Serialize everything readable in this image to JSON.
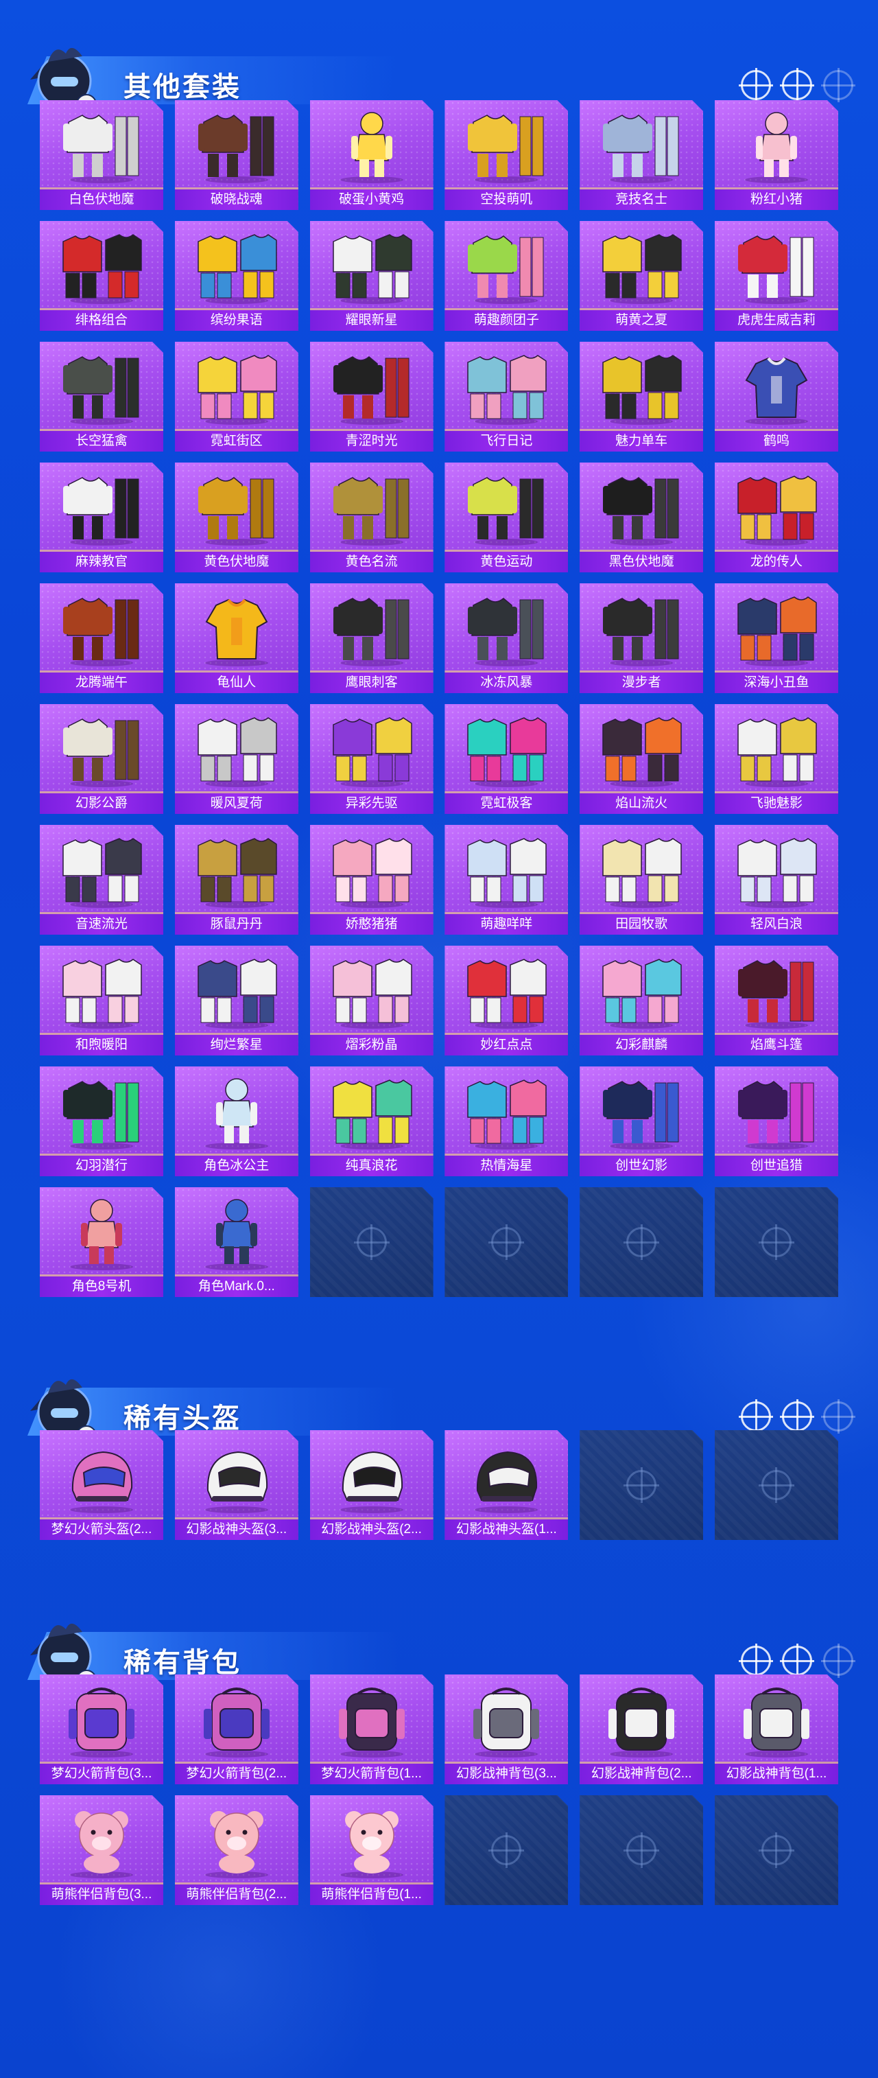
{
  "sections": [
    {
      "id": "suits",
      "title": "其他套装",
      "items": [
        {
          "name": "白色伏地魔",
          "kind": "suit",
          "colors": [
            "#eeeeee",
            "#cfcfcf"
          ]
        },
        {
          "name": "破晓战魂",
          "kind": "suit",
          "colors": [
            "#6b3b2a",
            "#3a2b2b"
          ]
        },
        {
          "name": "破蛋小黄鸡",
          "kind": "mascot",
          "colors": [
            "#ffd84a",
            "#fff1a8"
          ]
        },
        {
          "name": "空投萌叽",
          "kind": "suit",
          "colors": [
            "#f0c43a",
            "#d9a020"
          ]
        },
        {
          "name": "竞技名士",
          "kind": "suit",
          "colors": [
            "#9fb4d8",
            "#c6d3ea"
          ]
        },
        {
          "name": "粉红小猪",
          "kind": "mascot",
          "colors": [
            "#f7c0cf",
            "#ffe0e8"
          ]
        },
        {
          "name": "绯格组合",
          "kind": "set",
          "colors": [
            "#d42a2a",
            "#222222"
          ]
        },
        {
          "name": "缤纷果语",
          "kind": "set",
          "colors": [
            "#f4c21d",
            "#3a8fd8"
          ]
        },
        {
          "name": "耀眼新星",
          "kind": "set",
          "colors": [
            "#f2f2f2",
            "#2f3a2f"
          ]
        },
        {
          "name": "萌趣颜团子",
          "kind": "suit",
          "colors": [
            "#9ad84a",
            "#f08ab0"
          ]
        },
        {
          "name": "萌黄之夏",
          "kind": "set",
          "colors": [
            "#f3cf3a",
            "#2a2a2a"
          ]
        },
        {
          "name": "虎虎生威吉莉",
          "kind": "suit",
          "colors": [
            "#d42a3a",
            "#f5f5f5"
          ]
        },
        {
          "name": "长空猛禽",
          "kind": "suit",
          "colors": [
            "#4a4f4a",
            "#2b2f2b"
          ]
        },
        {
          "name": "霓虹街区",
          "kind": "set",
          "colors": [
            "#f5d43a",
            "#f08ac0"
          ]
        },
        {
          "name": "青涩时光",
          "kind": "suit",
          "colors": [
            "#222222",
            "#b42a2a"
          ]
        },
        {
          "name": "飞行日记",
          "kind": "set",
          "colors": [
            "#7fc2d8",
            "#f0a0c0"
          ]
        },
        {
          "name": "魅力单车",
          "kind": "set",
          "colors": [
            "#e8c42a",
            "#2a2a2a"
          ]
        },
        {
          "name": "鹤鸣",
          "kind": "hoodie",
          "colors": [
            "#3a4fb4",
            "#e8e8f0"
          ]
        },
        {
          "name": "麻辣教官",
          "kind": "suit",
          "colors": [
            "#f2f2f2",
            "#222222"
          ]
        },
        {
          "name": "黄色伏地魔",
          "kind": "suit",
          "colors": [
            "#d9a020",
            "#b07a10"
          ]
        },
        {
          "name": "黄色名流",
          "kind": "suit",
          "colors": [
            "#b0913a",
            "#8a6f2a"
          ]
        },
        {
          "name": "黄色运动",
          "kind": "suit",
          "colors": [
            "#d8e04a",
            "#2a2a2a"
          ]
        },
        {
          "name": "黑色伏地魔",
          "kind": "suit",
          "colors": [
            "#1e1e1e",
            "#3a3a3a"
          ]
        },
        {
          "name": "龙的传人",
          "kind": "set",
          "colors": [
            "#c8202a",
            "#f0c040"
          ]
        },
        {
          "name": "龙腾端午",
          "kind": "suit",
          "colors": [
            "#a8401e",
            "#6a2a14"
          ]
        },
        {
          "name": "龟仙人",
          "kind": "shirt",
          "colors": [
            "#f4b81a",
            "#f08a1a"
          ]
        },
        {
          "name": "鹰眼刺客",
          "kind": "suit",
          "colors": [
            "#2a2a2a",
            "#4a4a4a"
          ]
        },
        {
          "name": "冰冻风暴",
          "kind": "suit",
          "colors": [
            "#2f3338",
            "#4a5058"
          ]
        },
        {
          "name": "漫步者",
          "kind": "suit",
          "colors": [
            "#2a2a2a",
            "#3c3c3c"
          ]
        },
        {
          "name": "深海小丑鱼",
          "kind": "set",
          "colors": [
            "#2a3a6a",
            "#e86a2a"
          ]
        },
        {
          "name": "幻影公爵",
          "kind": "suit",
          "colors": [
            "#e8e4d8",
            "#6a4a2a"
          ]
        },
        {
          "name": "暖风夏荷",
          "kind": "set",
          "colors": [
            "#f2f2f2",
            "#c8c8c8"
          ]
        },
        {
          "name": "异彩先驱",
          "kind": "set",
          "colors": [
            "#8a3ad8",
            "#f0d040"
          ]
        },
        {
          "name": "霓虹极客",
          "kind": "set",
          "colors": [
            "#2ad0c0",
            "#e83a9a"
          ]
        },
        {
          "name": "焰山流火",
          "kind": "set",
          "colors": [
            "#3a2a3a",
            "#f0702a"
          ]
        },
        {
          "name": "飞驰魅影",
          "kind": "set",
          "colors": [
            "#f2f2f2",
            "#e8c840"
          ]
        },
        {
          "name": "音速流光",
          "kind": "set",
          "colors": [
            "#f2f2f2",
            "#3a3a4a"
          ]
        },
        {
          "name": "豚鼠丹丹",
          "kind": "set",
          "colors": [
            "#c8a040",
            "#5a4a2a"
          ]
        },
        {
          "name": "娇憨猪猪",
          "kind": "set",
          "colors": [
            "#f5a8c0",
            "#ffe0ea"
          ]
        },
        {
          "name": "萌趣咩咩",
          "kind": "set",
          "colors": [
            "#cfe0f5",
            "#f2f2f2"
          ]
        },
        {
          "name": "田园牧歌",
          "kind": "set",
          "colors": [
            "#f2e4b0",
            "#f2f2f2"
          ]
        },
        {
          "name": "轻风白浪",
          "kind": "set",
          "colors": [
            "#f2f2f2",
            "#dde6f5"
          ]
        },
        {
          "name": "和煦暖阳",
          "kind": "set",
          "colors": [
            "#f8d0e0",
            "#f2f2f2"
          ]
        },
        {
          "name": "绚烂繁星",
          "kind": "set",
          "colors": [
            "#3a4a8a",
            "#f2f2f2"
          ]
        },
        {
          "name": "熠彩粉晶",
          "kind": "set",
          "colors": [
            "#f5c0d8",
            "#f2f2f2"
          ]
        },
        {
          "name": "妙红点点",
          "kind": "set",
          "colors": [
            "#e0303a",
            "#f2f2f2"
          ]
        },
        {
          "name": "幻彩麒麟",
          "kind": "set",
          "colors": [
            "#f5a8d0",
            "#5ac8e0"
          ]
        },
        {
          "name": "焰鹰斗篷",
          "kind": "suit",
          "colors": [
            "#4a1a2a",
            "#c82a3a"
          ]
        },
        {
          "name": "幻羽潜行",
          "kind": "suit",
          "colors": [
            "#1e2a2a",
            "#2ad07a"
          ]
        },
        {
          "name": "角色冰公主",
          "kind": "figure",
          "colors": [
            "#cfe6f5",
            "#f2f2f2"
          ]
        },
        {
          "name": "纯真浪花",
          "kind": "set",
          "colors": [
            "#f0e040",
            "#4ac8a0"
          ]
        },
        {
          "name": "热情海星",
          "kind": "set",
          "colors": [
            "#3ab0e0",
            "#f06aa0"
          ]
        },
        {
          "name": "创世幻影",
          "kind": "suit",
          "colors": [
            "#1e2a5a",
            "#3a5ad0"
          ]
        },
        {
          "name": "创世追猎",
          "kind": "suit",
          "colors": [
            "#3a1a5a",
            "#d03ad0"
          ]
        },
        {
          "name": "角色8号机",
          "kind": "figure",
          "colors": [
            "#f0a0a0",
            "#c83a5a"
          ]
        },
        {
          "name": "角色Mark.0...",
          "kind": "figure",
          "colors": [
            "#3a6ad0",
            "#2a3a5a"
          ]
        }
      ],
      "empty_slots": 4
    },
    {
      "id": "helmets",
      "title": "稀有头盔",
      "items": [
        {
          "name": "梦幻火箭头盔(2...",
          "kind": "helmet",
          "colors": [
            "#e070c0",
            "#3a4ad0"
          ]
        },
        {
          "name": "幻影战神头盔(3...",
          "kind": "helmet",
          "colors": [
            "#f2f2f2",
            "#2a2a2a"
          ]
        },
        {
          "name": "幻影战神头盔(2...",
          "kind": "helmet",
          "colors": [
            "#f2f2f2",
            "#1e1e1e"
          ]
        },
        {
          "name": "幻影战神头盔(1...",
          "kind": "helmet",
          "colors": [
            "#2a2a2a",
            "#f2f2f2"
          ]
        }
      ],
      "empty_slots": 2
    },
    {
      "id": "backpacks",
      "title": "稀有背包",
      "items": [
        {
          "name": "梦幻火箭背包(3...",
          "kind": "backpack",
          "colors": [
            "#e070c0",
            "#5a3ad0"
          ]
        },
        {
          "name": "梦幻火箭背包(2...",
          "kind": "backpack",
          "colors": [
            "#d060c0",
            "#4a3ac0"
          ]
        },
        {
          "name": "梦幻火箭背包(1...",
          "kind": "backpack",
          "colors": [
            "#3a2a4a",
            "#e070c0"
          ]
        },
        {
          "name": "幻影战神背包(3...",
          "kind": "backpack",
          "colors": [
            "#f2f2f2",
            "#6a6a7a"
          ]
        },
        {
          "name": "幻影战神背包(2...",
          "kind": "backpack",
          "colors": [
            "#2a2a2a",
            "#f2f2f2"
          ]
        },
        {
          "name": "幻影战神背包(1...",
          "kind": "backpack",
          "colors": [
            "#5a5a6a",
            "#f2f2f2"
          ]
        },
        {
          "name": "萌熊伴侣背包(3...",
          "kind": "bear",
          "colors": [
            "#f5b0c8",
            "#ffe0ea"
          ]
        },
        {
          "name": "萌熊伴侣背包(2...",
          "kind": "bear",
          "colors": [
            "#f8b8c0",
            "#ffe8ee"
          ]
        },
        {
          "name": "萌熊伴侣背包(1...",
          "kind": "bear",
          "colors": [
            "#fcc8d0",
            "#fff0f4"
          ]
        }
      ],
      "empty_slots": 3
    }
  ]
}
